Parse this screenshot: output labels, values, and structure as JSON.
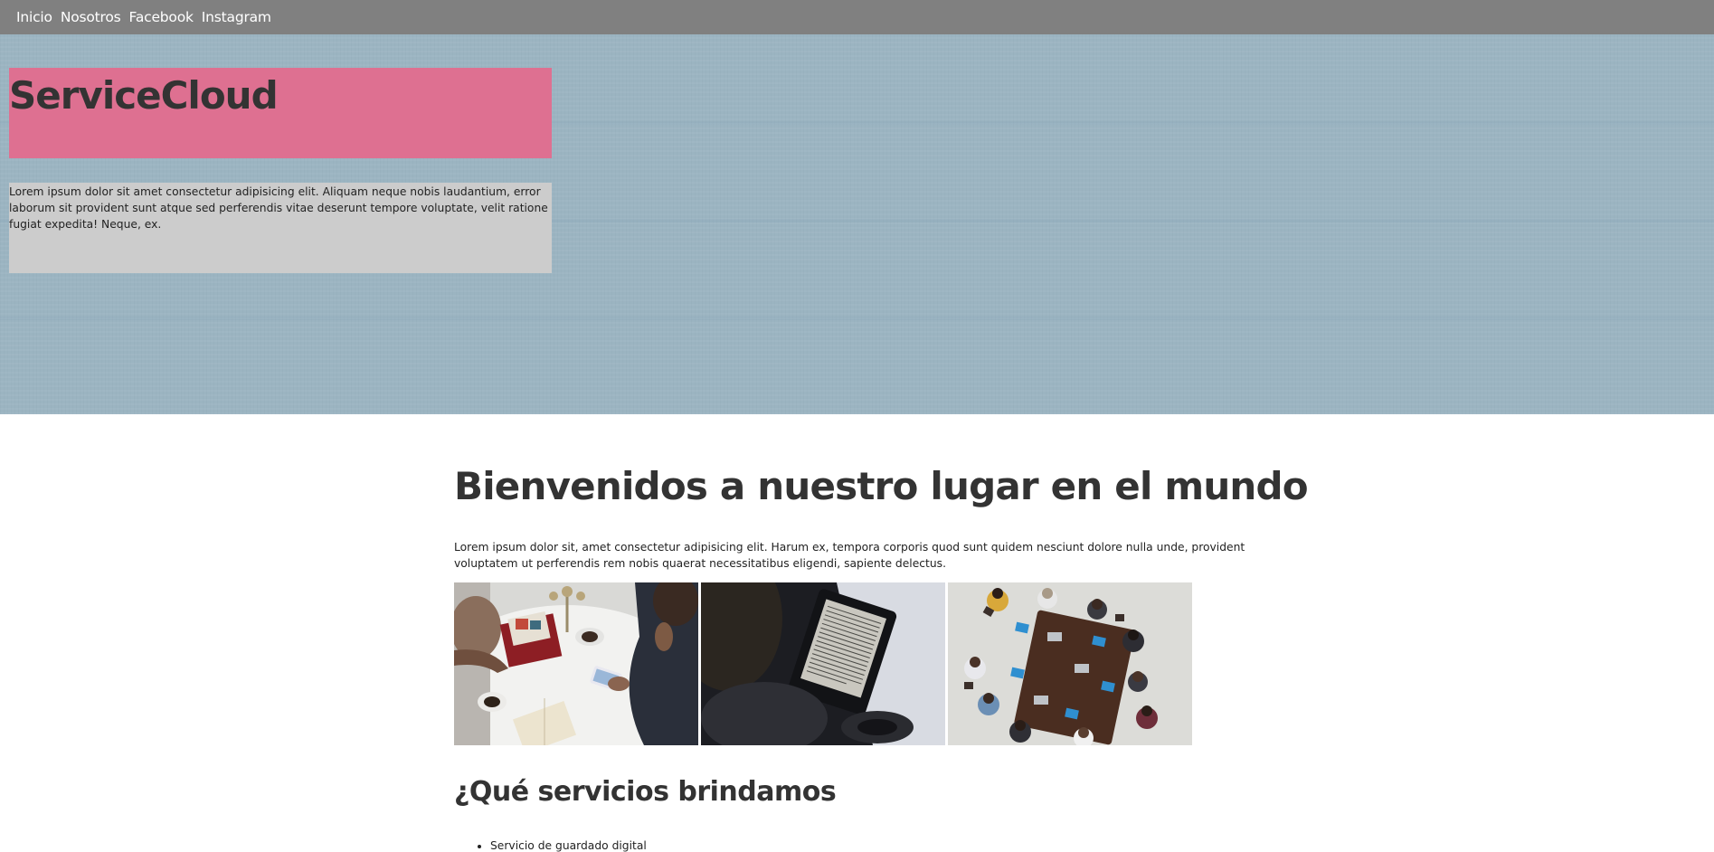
{
  "nav": {
    "items": [
      "Inicio",
      "Nosotros",
      "Facebook",
      "Instagram"
    ]
  },
  "hero": {
    "title": "ServiceCloud",
    "text": "Lorem ipsum dolor sit amet consectetur adipisicing elit. Aliquam neque nobis laudantium, error laborum sit provident sunt atque sed perferendis vitae deserunt tempore voluptate, velit ratione fugiat expedita! Neque, ex."
  },
  "main": {
    "heading": "Bienvenidos a nuestro lugar en el mundo",
    "intro": "Lorem ipsum dolor sit, amet consectetur adipisicing elit. Harum ex, tempora corporis quod sunt quidem nesciunt dolore nulla unde, provident voluptatem ut perferendis rem nobis quaerat necessitatibus eligendi, sapiente delectus.",
    "services_heading": "¿Qué servicios brindamos",
    "services": [
      "Servicio de guardado digital"
    ]
  },
  "colors": {
    "nav_bg": "#808080",
    "hero_bg": "#9bb4c1",
    "title_box": "#de7091",
    "text_box": "#cccccc",
    "heading_text": "#333333"
  }
}
